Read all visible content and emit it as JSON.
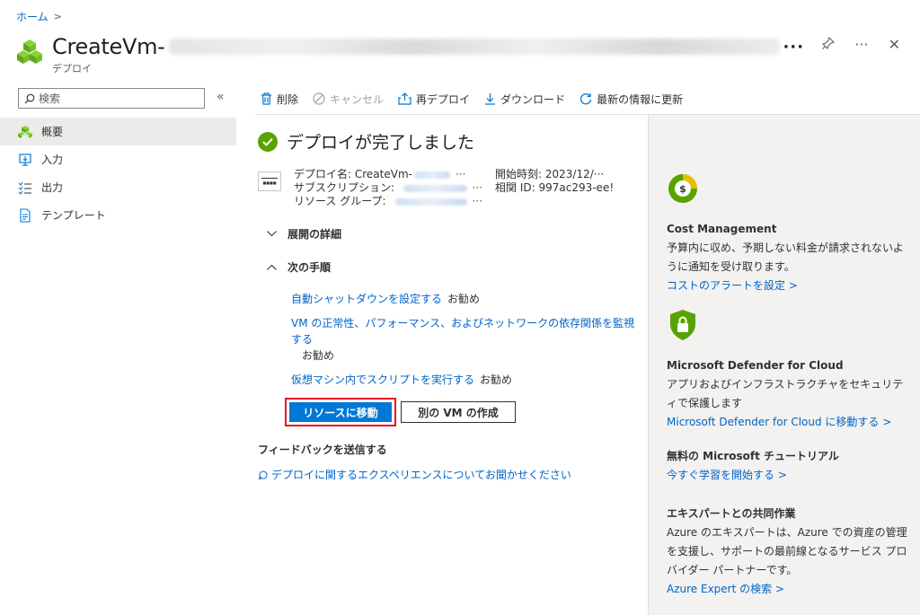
{
  "breadcrumb": {
    "home": "ホーム",
    "separator": ">"
  },
  "header": {
    "title": "CreateVm-",
    "title_overflow": "···",
    "subtitle": "デプロイ",
    "pin_icon": "pin-icon",
    "more_label": "···",
    "close_label": "✕"
  },
  "sidebar": {
    "search_placeholder": "検索",
    "collapse_label": "«",
    "items": [
      {
        "label": "概要",
        "icon": "overview-icon",
        "active": true
      },
      {
        "label": "入力",
        "icon": "inputs-icon",
        "active": false
      },
      {
        "label": "出力",
        "icon": "outputs-icon",
        "active": false
      },
      {
        "label": "テンプレート",
        "icon": "template-icon",
        "active": false
      }
    ]
  },
  "toolbar": {
    "delete": "削除",
    "cancel": "キャンセル",
    "redeploy": "再デプロイ",
    "download": "ダウンロード",
    "refresh": "最新の情報に更新"
  },
  "main": {
    "status_title": "デプロイが完了しました",
    "deployment_name_label": "デプロイ名:",
    "deployment_name_value": "CreateVm-",
    "subscription_label": "サブスクリプション:",
    "resource_group_label": "リソース グループ:",
    "ellipsis": "···",
    "start_time_label": "開始時刻:",
    "start_time_value": "2023/12/···",
    "correlation_id_label": "相関 ID:",
    "correlation_id_value": "997ac293-ee!",
    "deployment_details": "展開の詳細",
    "next_steps": "次の手順",
    "steps": [
      {
        "link": "自動シャットダウンを設定する",
        "tag": "お勧め"
      },
      {
        "link": "VM の正常性、パフォーマンス、およびネットワークの依存関係を監視する",
        "tag": "お勧め"
      },
      {
        "link": "仮想マシン内でスクリプトを実行する",
        "tag": "お勧め"
      }
    ],
    "go_to_resource": "リソースに移動",
    "create_another_vm": "別の VM の作成",
    "feedback_title": "フィードバックを送信する",
    "feedback_link": "デプロイに関するエクスペリエンスについてお聞かせください"
  },
  "right_panel": {
    "cost": {
      "title": "Cost Management",
      "text": "予算内に収め、予期しない料金が請求されないように通知を受け取ります。",
      "link": "コストのアラートを設定 >"
    },
    "defender": {
      "title": "Microsoft Defender for Cloud",
      "text": "アプリおよびインフラストラクチャをセキュリティで保護します",
      "link": "Microsoft Defender for Cloud に移動する >"
    },
    "tutorial": {
      "title": "無料の Microsoft チュートリアル",
      "link": "今すぐ学習を開始する >"
    },
    "expert": {
      "title": "エキスパートとの共同作業",
      "text": "Azure のエキスパートは、Azure での資産の管理を支援し、サポートの最前線となるサービス プロバイダー パートナーです。",
      "link": "Azure Expert の検索 >"
    }
  },
  "colors": {
    "accent": "#0078d4",
    "link": "#0064c8",
    "success": "#57a300",
    "highlight_border": "#e81123",
    "panel_bg": "#f3f2f1"
  }
}
